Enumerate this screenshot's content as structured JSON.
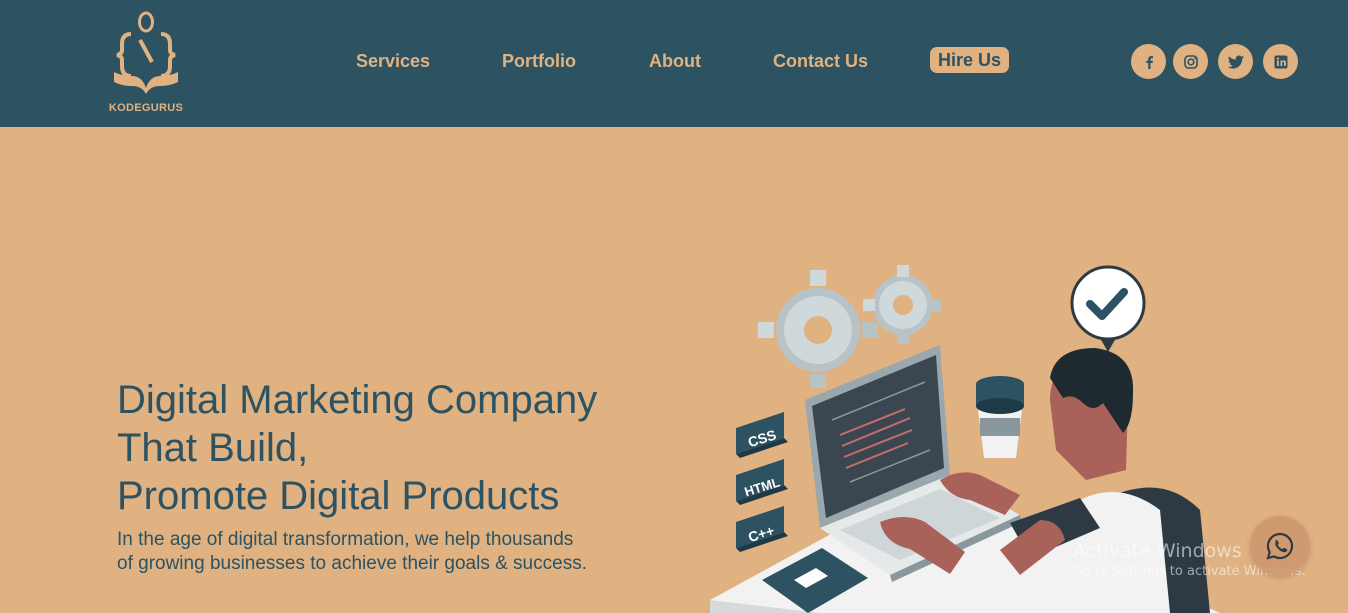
{
  "brand": {
    "name": "KODEGURUS"
  },
  "nav": {
    "items": [
      {
        "label": "Services"
      },
      {
        "label": "Portfolio"
      },
      {
        "label": "About"
      },
      {
        "label": "Contact Us"
      }
    ],
    "cta_label": "Hire Us"
  },
  "social": [
    {
      "icon": "facebook-icon"
    },
    {
      "icon": "instagram-icon"
    },
    {
      "icon": "twitter-icon"
    },
    {
      "icon": "linkedin-icon"
    }
  ],
  "hero": {
    "headline_lines": [
      "Digital Marketing Company",
      "That Build,",
      "Promote Digital Products"
    ],
    "subtext_lines": [
      "In the age of digital transformation, we help thousands",
      "of growing businesses to achieve their goals & success."
    ]
  },
  "illustration": {
    "labels": [
      "CSS",
      "HTML",
      "C++"
    ]
  },
  "overlay": {
    "activate_title": "Activate Windows",
    "activate_sub": "Go to Settings to activate Windows."
  },
  "colors": {
    "header": "#2d5363",
    "accent": "#e0b181",
    "text": "#2d5363"
  }
}
